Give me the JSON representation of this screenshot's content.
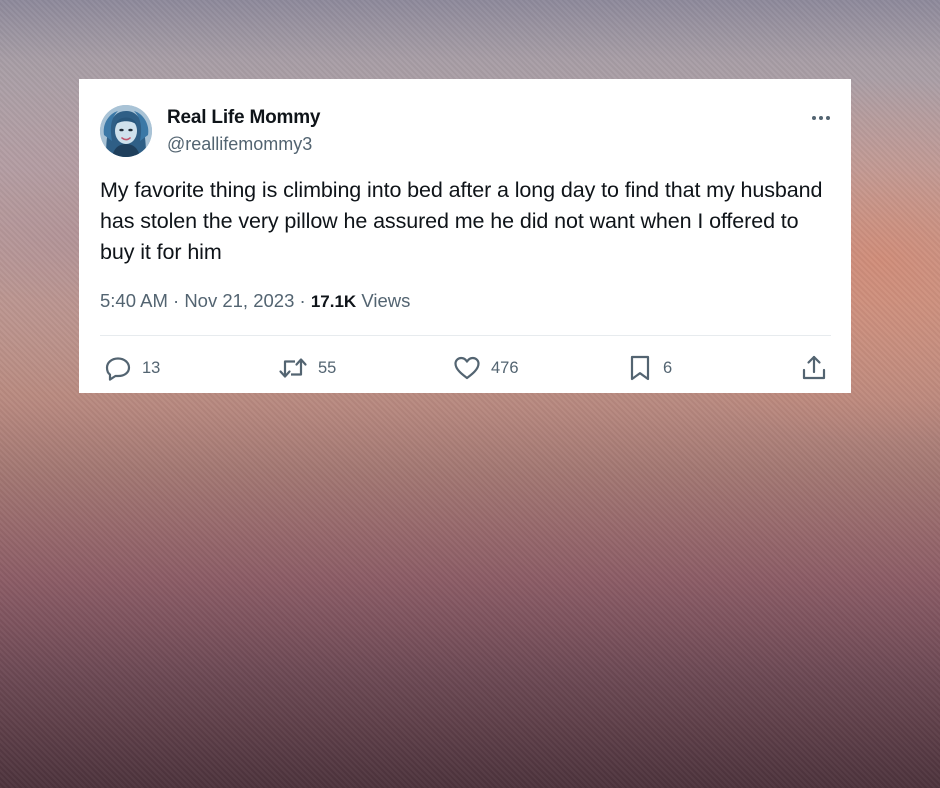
{
  "tweet": {
    "author_name": "Real Life Mommy",
    "author_handle": "@reallifemommy3",
    "text": "My favorite thing is climbing into bed after a long day to find that my husband has stolen the very pillow he assured me he did not want when I offered to buy it for him",
    "timestamp": "5:40 AM · Nov 21, 2023",
    "separator": " · ",
    "views_count": "17.1K",
    "views_label": " Views"
  },
  "actions": {
    "replies": "13",
    "retweets": "55",
    "likes": "476",
    "bookmarks": "6"
  },
  "icons": {
    "reply": "reply-icon",
    "retweet": "retweet-icon",
    "like": "heart-icon",
    "bookmark": "bookmark-icon",
    "share": "share-icon",
    "more": "more-icon"
  },
  "colors": {
    "card_bg": "#ffffff",
    "primary_text": "#0f1419",
    "secondary_text": "#536471",
    "divider": "#e7ebee"
  }
}
